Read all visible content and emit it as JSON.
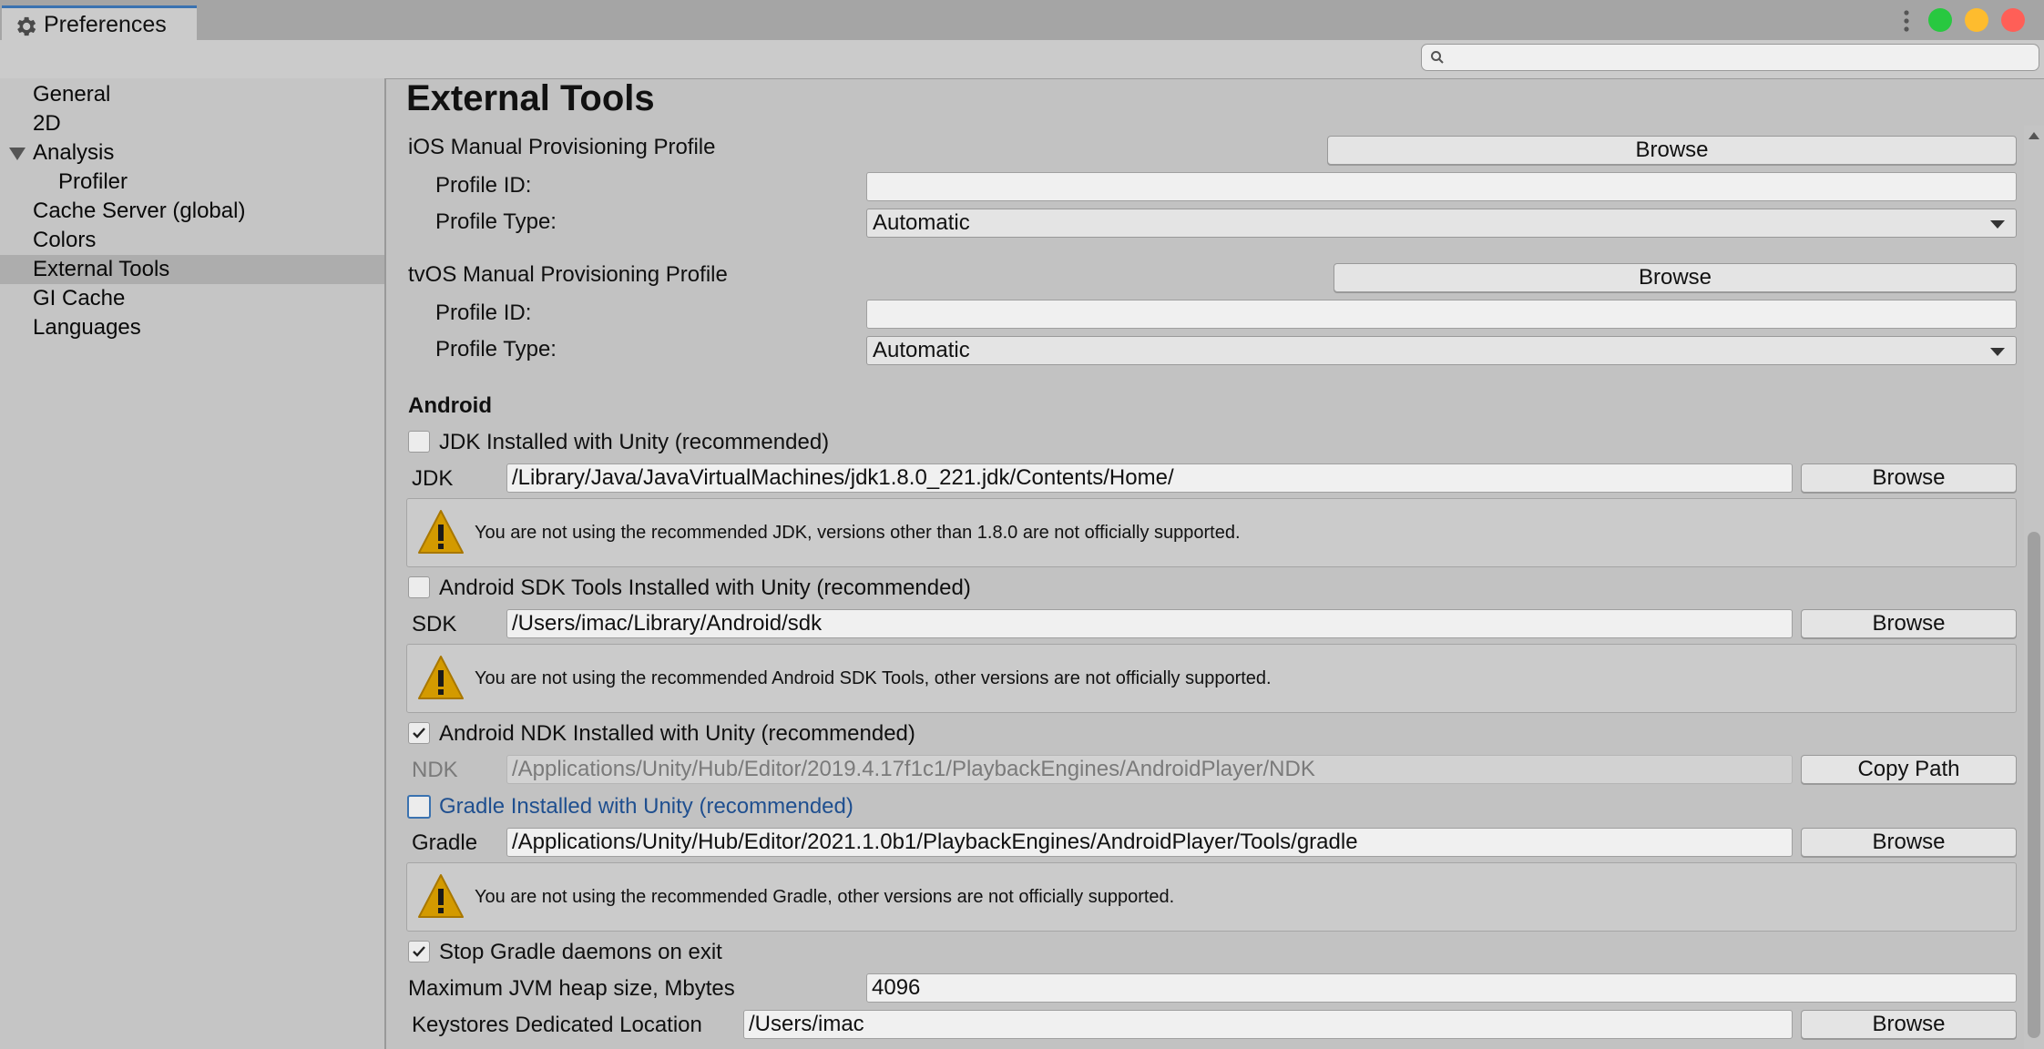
{
  "window": {
    "tab_title": "Preferences",
    "search_placeholder": "",
    "traffic_light_colors": [
      "#28c840",
      "#febc2e",
      "#ff5f57"
    ]
  },
  "sidebar": {
    "items": [
      {
        "label": "General"
      },
      {
        "label": "2D"
      },
      {
        "label": "Analysis"
      },
      {
        "label": "Profiler"
      },
      {
        "label": "Cache Server (global)"
      },
      {
        "label": "Colors"
      },
      {
        "label": "External Tools"
      },
      {
        "label": "GI Cache"
      },
      {
        "label": "Languages"
      }
    ]
  },
  "main": {
    "title": "External Tools",
    "ios": {
      "section": "iOS Manual Provisioning Profile",
      "browse": "Browse",
      "profile_id_label": "Profile ID:",
      "profile_id_value": "",
      "profile_type_label": "Profile Type:",
      "profile_type_value": "Automatic"
    },
    "tvos": {
      "section": "tvOS Manual Provisioning Profile",
      "browse": "Browse",
      "profile_id_label": "Profile ID:",
      "profile_id_value": "",
      "profile_type_label": "Profile Type:",
      "profile_type_value": "Automatic"
    },
    "android": {
      "heading": "Android",
      "jdk_toggle": "JDK Installed with Unity (recommended)",
      "jdk_checked": false,
      "jdk_label": "JDK",
      "jdk_path": "/Library/Java/JavaVirtualMachines/jdk1.8.0_221.jdk/Contents/Home/",
      "jdk_browse": "Browse",
      "jdk_warning": "You are not using the recommended JDK, versions other than 1.8.0 are not officially supported.",
      "sdk_toggle": "Android SDK Tools Installed with Unity (recommended)",
      "sdk_checked": false,
      "sdk_label": "SDK",
      "sdk_path": "/Users/imac/Library/Android/sdk",
      "sdk_browse": "Browse",
      "sdk_warning": "You are not using the recommended Android SDK Tools, other versions are not officially supported.",
      "ndk_toggle": "Android NDK Installed with Unity (recommended)",
      "ndk_checked": true,
      "ndk_label": "NDK",
      "ndk_path": "/Applications/Unity/Hub/Editor/2019.4.17f1c1/PlaybackEngines/AndroidPlayer/NDK",
      "ndk_copy": "Copy Path",
      "gradle_toggle": "Gradle Installed with Unity (recommended)",
      "gradle_checked": false,
      "gradle_label": "Gradle",
      "gradle_path": "/Applications/Unity/Hub/Editor/2021.1.0b1/PlaybackEngines/AndroidPlayer/Tools/gradle",
      "gradle_browse": "Browse",
      "gradle_warning": "You are not using the recommended Gradle, other versions are not officially supported.",
      "stop_daemons": "Stop Gradle daemons on exit",
      "stop_daemons_checked": true,
      "heap_label": "Maximum JVM heap size, Mbytes",
      "heap_value": "4096",
      "keystore_label": "Keystores Dedicated Location",
      "keystore_value": "/Users/imac",
      "keystore_browse": "Browse"
    }
  },
  "colors": {
    "accent": "#3a72b0",
    "warning_icon": "#d39a00",
    "link_text": "#1f4f8f"
  }
}
